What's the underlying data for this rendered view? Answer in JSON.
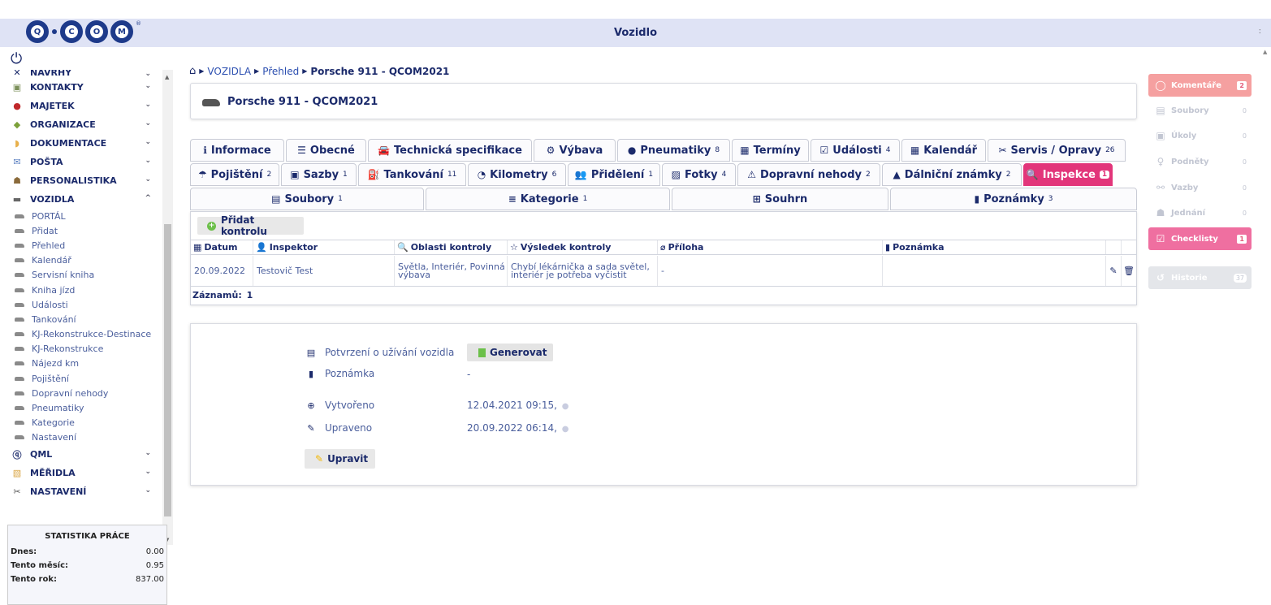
{
  "topbar": {
    "logo": "Q·COM",
    "title": "Vozidlo",
    "kebab": ":"
  },
  "sidebar": {
    "menu": [
      {
        "label": "NÁVRHY",
        "icon": "compass-icon",
        "chevron": "⌄"
      },
      {
        "label": "KONTAKTY",
        "icon": "contacts-icon",
        "chevron": "⌄"
      },
      {
        "label": "MAJETEK",
        "icon": "property-icon",
        "chevron": "⌄"
      },
      {
        "label": "ORGANIZACE",
        "icon": "organization-icon",
        "chevron": "⌄"
      },
      {
        "label": "DOKUMENTACE",
        "icon": "documents-icon",
        "chevron": "⌄"
      },
      {
        "label": "POŠTA",
        "icon": "mail-icon",
        "chevron": "⌄"
      },
      {
        "label": "PERSONALISTIKA",
        "icon": "personnel-icon",
        "chevron": "⌄"
      },
      {
        "label": "VOZIDLA",
        "icon": "car-icon",
        "chevron": "^"
      }
    ],
    "vozidla_items": [
      "PORTÁL",
      "Přidat",
      "Přehled",
      "Kalendář",
      "Servisní kniha",
      "Kniha jízd",
      "Události",
      "Tankování",
      "KJ-Rekonstrukce-Destinace",
      "KJ-Rekonstrukce",
      "Nájezd km",
      "Pojištění",
      "Dopravní nehody",
      "Pneumatiky",
      "Kategorie",
      "Nastavení"
    ],
    "menu_after": [
      {
        "label": "QML",
        "icon": "qml-icon",
        "chevron": "⌄"
      },
      {
        "label": "MĚŘIDLA",
        "icon": "gauge-icon",
        "chevron": "⌄"
      },
      {
        "label": "NASTAVENÍ",
        "icon": "tools-icon",
        "chevron": "⌄"
      }
    ],
    "stats": {
      "title": "STATISTIKA PRÁCE",
      "rows": [
        {
          "label": "Dnes:",
          "value": "0.00"
        },
        {
          "label": "Tento měsíc:",
          "value": "0.95"
        },
        {
          "label": "Tento rok:",
          "value": "837.00"
        }
      ]
    }
  },
  "breadcrumb": {
    "vozidla": "VOZIDLA",
    "prehled": "Přehled",
    "current": "Porsche 911 - QCOM2021"
  },
  "header": {
    "title": "Porsche 911 - QCOM2021"
  },
  "tabs_row1": [
    {
      "label": "Informace",
      "icon": "ℹ",
      "count": ""
    },
    {
      "label": "Obecné",
      "icon": "☰",
      "count": ""
    },
    {
      "label": "Technická specifikace",
      "icon": "🚘",
      "count": ""
    },
    {
      "label": "Výbava",
      "icon": "⚙",
      "count": ""
    },
    {
      "label": "Pneumatiky",
      "icon": "●",
      "count": "8"
    },
    {
      "label": "Termíny",
      "icon": "▦",
      "count": ""
    },
    {
      "label": "Události",
      "icon": "☑",
      "count": "4"
    },
    {
      "label": "Kalendář",
      "icon": "▦",
      "count": ""
    },
    {
      "label": "Servis / Opravy",
      "icon": "✂",
      "count": "26"
    }
  ],
  "tabs_row2": [
    {
      "label": "Pojištění",
      "icon": "☂",
      "count": "2"
    },
    {
      "label": "Sazby",
      "icon": "▣",
      "count": "1"
    },
    {
      "label": "Tankování",
      "icon": "⛽",
      "count": "11"
    },
    {
      "label": "Kilometry",
      "icon": "◔",
      "count": "6"
    },
    {
      "label": "Přidělení",
      "icon": "👥",
      "count": "1"
    },
    {
      "label": "Fotky",
      "icon": "▨",
      "count": "4"
    },
    {
      "label": "Dopravní nehody",
      "icon": "⚠",
      "count": "2"
    },
    {
      "label": "Dálniční známky",
      "icon": "▲",
      "count": "2"
    },
    {
      "label": "Inspekce",
      "icon": "🔍",
      "count": "1"
    }
  ],
  "tabs_row3": [
    {
      "label": "Soubory",
      "icon": "▤",
      "count": "1"
    },
    {
      "label": "Kategorie",
      "icon": "≡",
      "count": "1"
    },
    {
      "label": "Souhrn",
      "icon": "⊞",
      "count": ""
    },
    {
      "label": "Poznámky",
      "icon": "▮",
      "count": "3"
    }
  ],
  "inspection": {
    "add_label": "Přidat kontrolu",
    "columns": [
      "Datum",
      "Inspektor",
      "Oblasti kontroly",
      "Výsledek kontroly",
      "Příloha",
      "Poznámka"
    ],
    "row": {
      "datum": "20.09.2022",
      "inspektor": "Testovič Test",
      "oblasti": "Světla, Interiér, Povinná výbava",
      "vysledek": "Chybí lékárnička a sada světel, interiér je potřeba vyčistit",
      "priloha": "-",
      "poznamka": ""
    },
    "records_label": "Záznamů:",
    "records_count": "1"
  },
  "detail": {
    "potvrzeni_label": "Potvrzení o užívání vozidla",
    "generate_label": "Generovat",
    "poznamka_label": "Poznámka",
    "poznamka_value": "-",
    "vytvoreno_label": "Vytvořeno",
    "vytvoreno_value": "12.04.2021 09:15,",
    "upraveno_label": "Upraveno",
    "upraveno_value": "20.09.2022 06:14,",
    "edit_label": "Upravit"
  },
  "widgets": [
    {
      "label": "Komentáře",
      "count": "2"
    },
    {
      "label": "Soubory",
      "count": "0"
    },
    {
      "label": "Úkoly",
      "count": "0"
    },
    {
      "label": "Podněty",
      "count": "0"
    },
    {
      "label": "Vazby",
      "count": "0"
    },
    {
      "label": "Jednání",
      "count": "0"
    },
    {
      "label": "Checklisty",
      "count": "1"
    },
    {
      "label": "Historie",
      "count": "37"
    }
  ],
  "colors": {
    "accent": "#e2357a",
    "navy": "#1b2a6b",
    "green": "#6cc04a",
    "komentare": "#f5a0a0",
    "checklisty": "#ef6fa0"
  }
}
